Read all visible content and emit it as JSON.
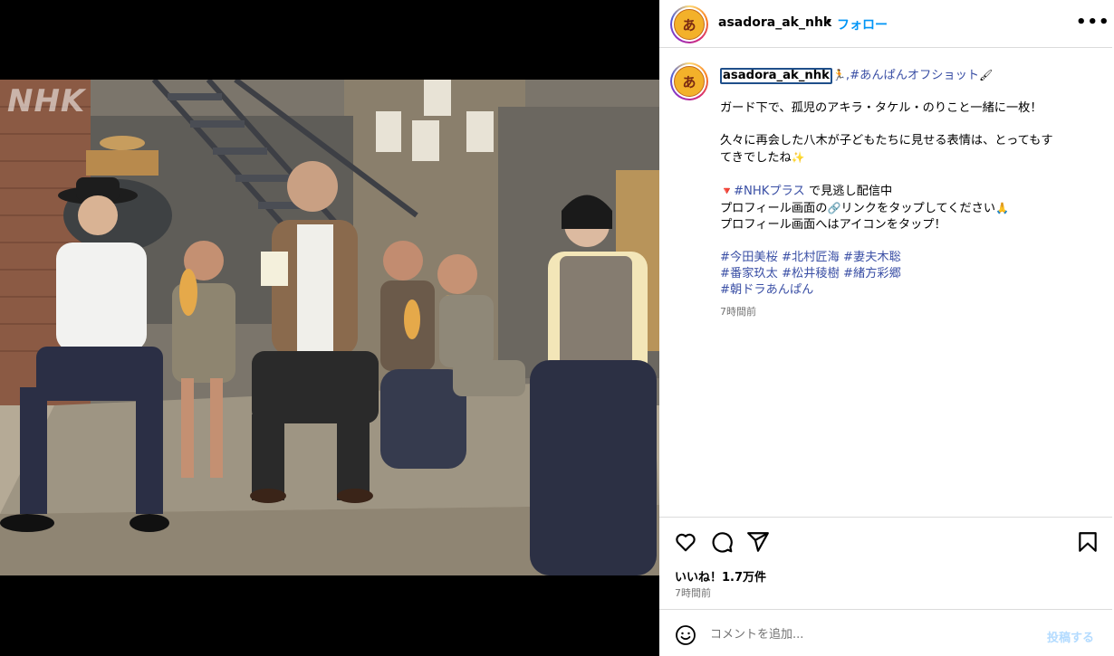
{
  "media": {
    "watermark": "NHK"
  },
  "header": {
    "avatar_text": "あ",
    "username": "asadora_ak_nhk",
    "separator": "•",
    "follow_label": "フォロー",
    "more_label": "•••"
  },
  "caption": {
    "avatar_text": "あ",
    "username": "asadora_ak_nhk",
    "line1_emoji": "🏃",
    "line1_tag": ",#あんぱんオフショット",
    "line1_emoji2": "🖌",
    "line2": "ガード下で、孤児のアキラ・タケル・のりこと一緒に一枚！",
    "line3a": "久々に再会した八木が子どもたちに見せる表情は、とってもす",
    "line3b": "てきでしたね",
    "line3b_emoji": "✨",
    "line4_emoji": "🔻",
    "line4_tag": "#NHKプラス",
    "line4_text": " で見逃し配信中",
    "line5a": "プロフィール画面の",
    "line5_emoji": "🔗",
    "line5b": "リンクをタップしてください",
    "line5_emoji2": "🙏",
    "line6": "プロフィール画面へはアイコンをタップ！",
    "tags_row1": "#今田美桜 #北村匠海 #妻夫木聡",
    "tags_row2": "#番家玖太 #松井稜樹 #緒方彩郷",
    "tags_row3": "#朝ドラあんぱん",
    "time_ago": "7時間前"
  },
  "actions": {
    "likes": "いいね！1.7万件",
    "time": "7時間前"
  },
  "comment": {
    "placeholder": "コメントを追加...",
    "post_label": "投稿する"
  }
}
